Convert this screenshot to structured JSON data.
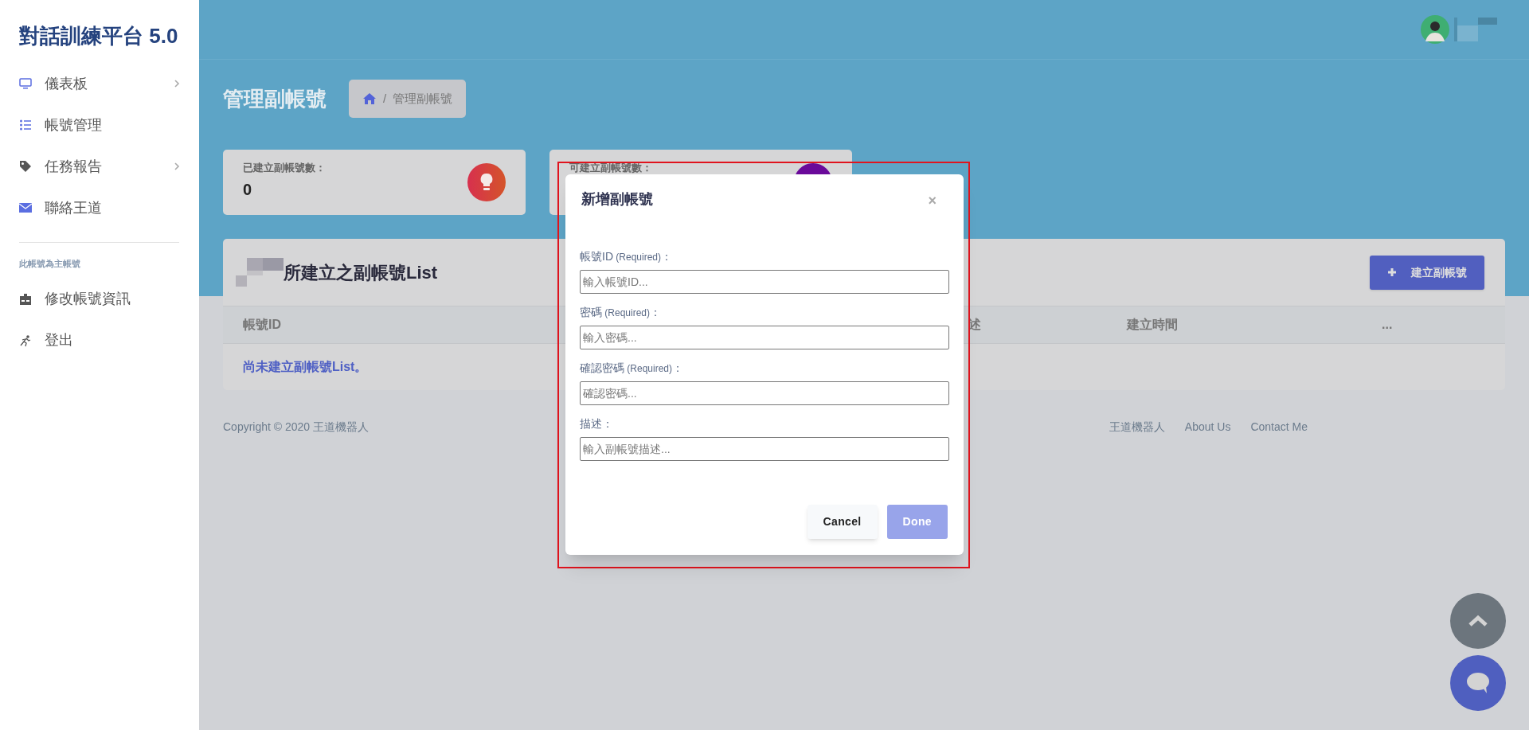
{
  "sidebar": {
    "title": "對話訓練平台 5.0",
    "items": [
      {
        "label": "儀表板",
        "expandable": true
      },
      {
        "label": "帳號管理",
        "expandable": false
      },
      {
        "label": "任務報告",
        "expandable": true
      },
      {
        "label": "聯絡王道",
        "expandable": false
      }
    ],
    "section_label": "此帳號為主帳號",
    "account_items": [
      {
        "label": "修改帳號資訊"
      },
      {
        "label": "登出"
      }
    ]
  },
  "page": {
    "title": "管理副帳號",
    "breadcrumb": "管理副帳號",
    "breadcrumb_separator": "/"
  },
  "stats": [
    {
      "label": "已建立副帳號數：",
      "value": "0"
    },
    {
      "label": "可建立副帳號數："
    }
  ],
  "list": {
    "title": "所建立之副帳號List",
    "add_button": "建立副帳號",
    "columns": [
      "帳號ID",
      "述",
      "建立時間",
      "..."
    ],
    "empty_message": "尚未建立副帳號List。"
  },
  "footer": {
    "copyright": "Copyright © 2020 王道機器人",
    "links": [
      "王道機器人",
      "About Us",
      "Contact Me"
    ]
  },
  "modal": {
    "title": "新增副帳號",
    "close": "×",
    "fields": [
      {
        "label": "帳號ID",
        "note": "(Required)",
        "suffix": "：",
        "placeholder": "輸入帳號ID..."
      },
      {
        "label": "密碼",
        "note": "(Required)",
        "suffix": "：",
        "placeholder": "輸入密碼..."
      },
      {
        "label": "確認密碼",
        "note": "(Required)",
        "suffix": "：",
        "placeholder": "確認密碼..."
      },
      {
        "label": "描述",
        "suffix": "：",
        "placeholder": "輸入副帳號描述..."
      }
    ],
    "buttons": [
      {
        "label": "Cancel",
        "kind": "secondary",
        "disabled": false
      },
      {
        "label": "Done",
        "kind": "primary",
        "disabled": true
      }
    ]
  }
}
